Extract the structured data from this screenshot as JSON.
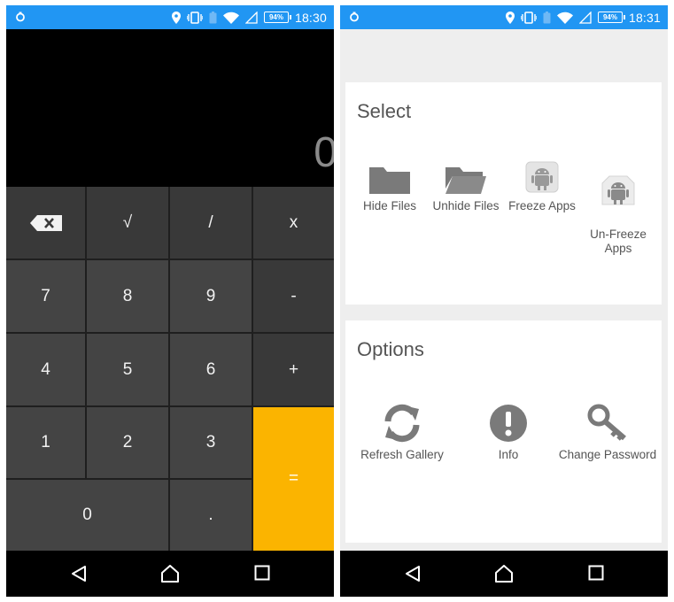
{
  "left_screen": {
    "status_bar": {
      "battery": "94%",
      "time": "18:30"
    },
    "display": {
      "value": "0"
    },
    "keys": [
      {
        "id": "backspace",
        "label": ""
      },
      {
        "id": "sqrt",
        "label": "√"
      },
      {
        "id": "divide",
        "label": "/"
      },
      {
        "id": "multiply",
        "label": "x"
      },
      {
        "id": "7",
        "label": "7"
      },
      {
        "id": "8",
        "label": "8"
      },
      {
        "id": "9",
        "label": "9"
      },
      {
        "id": "minus",
        "label": "-"
      },
      {
        "id": "4",
        "label": "4"
      },
      {
        "id": "5",
        "label": "5"
      },
      {
        "id": "6",
        "label": "6"
      },
      {
        "id": "plus",
        "label": "+"
      },
      {
        "id": "1",
        "label": "1"
      },
      {
        "id": "2",
        "label": "2"
      },
      {
        "id": "3",
        "label": "3"
      },
      {
        "id": "equals",
        "label": "="
      },
      {
        "id": "0",
        "label": "0"
      },
      {
        "id": "dot",
        "label": "."
      }
    ],
    "nav": [
      "back-icon",
      "home-icon",
      "recents-icon"
    ]
  },
  "right_screen": {
    "status_bar": {
      "battery": "94%",
      "time": "18:31"
    },
    "select": {
      "title": "Select",
      "items": [
        {
          "label": "Hide Files",
          "icon": "folder-icon"
        },
        {
          "label": "Unhide Files",
          "icon": "open-folder-icon"
        },
        {
          "label": "Freeze Apps",
          "icon": "frozen-android-icon"
        },
        {
          "label": "Un-Freeze\nApps",
          "icon": "unfrozen-android-icon"
        }
      ]
    },
    "options": {
      "title": "Options",
      "items": [
        {
          "label": "Refresh Gallery",
          "icon": "refresh-icon"
        },
        {
          "label": "Info",
          "icon": "info-icon"
        },
        {
          "label": "Change Password",
          "icon": "key-icon"
        }
      ]
    }
  },
  "colors": {
    "status_bar": "#2196f3",
    "key_dark": "#444444",
    "key_operator": "#393939",
    "equals_key": "#fbb400",
    "icon_gray": "#7a7a7a"
  }
}
